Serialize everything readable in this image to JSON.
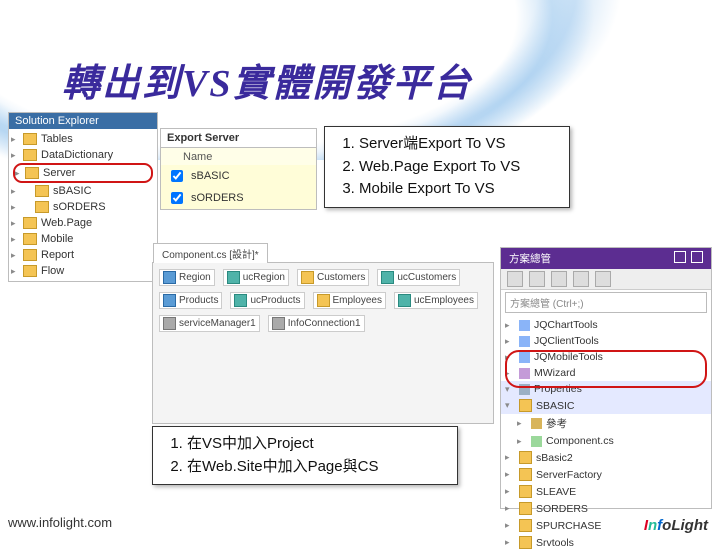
{
  "slide": {
    "title": "轉出到VS實體開發平台",
    "footer_url": "www.infolight.com"
  },
  "solution_explorer": {
    "title": "Solution Explorer",
    "items": [
      {
        "label": "Tables"
      },
      {
        "label": "DataDictionary"
      },
      {
        "label": "Server",
        "highlight": true
      },
      {
        "label": "sBASIC",
        "indent": true
      },
      {
        "label": "sORDERS",
        "indent": true
      },
      {
        "label": "Web.Page"
      },
      {
        "label": "Mobile"
      },
      {
        "label": "Report"
      },
      {
        "label": "Flow"
      }
    ]
  },
  "export_server": {
    "title": "Export Server",
    "header": "Name",
    "items": [
      {
        "label": "sBASIC",
        "checked": true
      },
      {
        "label": "sORDERS",
        "checked": true
      }
    ]
  },
  "callout_top": {
    "items": [
      "Server端Export To VS",
      "Web.Page Export To VS",
      "Mobile Export To VS"
    ]
  },
  "callout_bottom": {
    "items": [
      "在VS中加入Project",
      "在Web.Site中加入Page與CS"
    ]
  },
  "vs_designer": {
    "tab": "Component.cs [設計]*",
    "components": [
      {
        "name": "Region",
        "icon": "ic-blue"
      },
      {
        "name": "ucRegion",
        "icon": "ic-teal"
      },
      {
        "name": "Customers",
        "icon": "ic-yel"
      },
      {
        "name": "ucCustomers",
        "icon": "ic-teal"
      },
      {
        "name": "Products",
        "icon": "ic-blue"
      },
      {
        "name": "ucProducts",
        "icon": "ic-teal"
      },
      {
        "name": "Employees",
        "icon": "ic-yel"
      },
      {
        "name": "ucEmployees",
        "icon": "ic-teal"
      },
      {
        "name": "serviceManager1",
        "icon": "ic-grey"
      },
      {
        "name": "InfoConnection1",
        "icon": "ic-grey"
      }
    ]
  },
  "tools_panel": {
    "title": "方案總管",
    "search_placeholder": "方案總管 (Ctrl+;)",
    "items": [
      {
        "label": "JQChartTools",
        "icon": "t-tool"
      },
      {
        "label": "JQClientTools",
        "icon": "t-tool"
      },
      {
        "label": "JQMobileTools",
        "icon": "t-tool"
      },
      {
        "label": "MWizard",
        "icon": "t-wand"
      },
      {
        "label": "Properties",
        "icon": "t-wrench",
        "sel": true,
        "open": true
      },
      {
        "label": "SBASIC",
        "icon": "t-folder",
        "sel": true,
        "open": true
      },
      {
        "label": "參考",
        "icon": "t-node",
        "l2": true
      },
      {
        "label": "Component.cs",
        "icon": "t-csharp",
        "l2": true
      },
      {
        "label": "sBasic2",
        "icon": "t-folder"
      },
      {
        "label": "ServerFactory",
        "icon": "t-folder"
      },
      {
        "label": "SLEAVE",
        "icon": "t-folder"
      },
      {
        "label": "SORDERS",
        "icon": "t-folder"
      },
      {
        "label": "SPURCHASE",
        "icon": "t-folder"
      },
      {
        "label": "Srvtools",
        "icon": "t-folder"
      }
    ]
  }
}
